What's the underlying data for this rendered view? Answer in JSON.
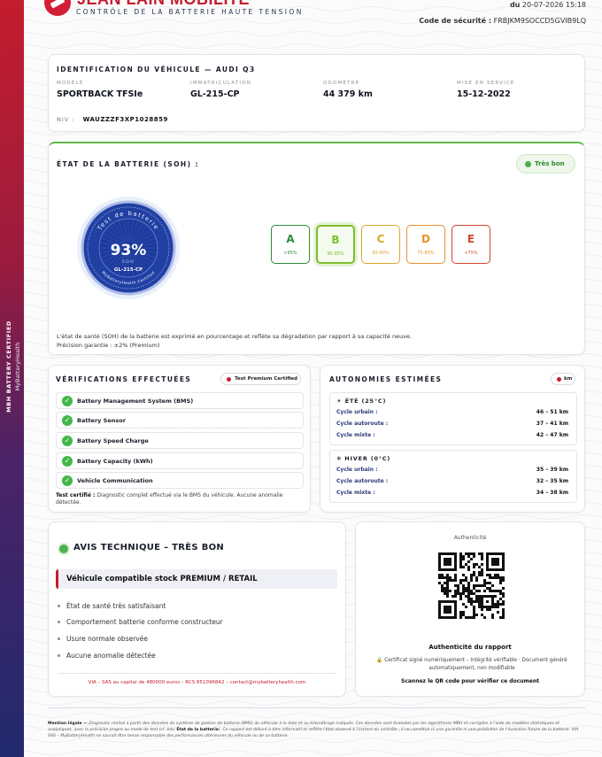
{
  "header": {
    "brand": "JEAN LAIN MOBILITÉ",
    "subtitle": "CONTRÔLE DE LA BATTERIE HAUTE TENSION",
    "date_prefix": "du",
    "date_value": "20-07-2026 15:18",
    "code_label": "Code de sécurité :",
    "code_value": "FRBJKM9SOCCD5GVIB9LQ"
  },
  "sidebar": {
    "line1": "MBH BATTERY CERTIFIED",
    "line2": "MyBatteryHealth"
  },
  "vehicle": {
    "title": "IDENTIFICATION DU VÉHICULE — AUDI Q3",
    "fields": [
      {
        "label": "MODÈLE",
        "value": "SPORTBACK TFSIe"
      },
      {
        "label": "IMMATRICULATION",
        "value": "GL-215-CP"
      },
      {
        "label": "ODOMÈTRE",
        "value": "44 379 km"
      },
      {
        "label": "MISE EN SERVICE",
        "value": "15-12-2022"
      }
    ],
    "vin_label": "NIV :",
    "vin_value": "WAUZZZF3XP1028859"
  },
  "battery": {
    "title": "ÉTAT DE LA BATTERIE (SOH) :",
    "status": "Très bon",
    "seal": {
      "top_text": "Test de batterie",
      "percent": "93%",
      "soh_label": "SOH",
      "plate": "GL-215-CP",
      "bottom_text": "MyBatteryHealth Certified"
    },
    "soh_value": 93,
    "grades": [
      {
        "letter": "A",
        "range": ">95%",
        "color": "#2e8b3d",
        "selected": false
      },
      {
        "letter": "B",
        "range": "90-95%",
        "color": "#7cbf2e",
        "selected": true
      },
      {
        "letter": "C",
        "range": "85-90%",
        "color": "#d8a82a",
        "selected": false
      },
      {
        "letter": "D",
        "range": "75-85%",
        "color": "#e8902e",
        "selected": false
      },
      {
        "letter": "E",
        "range": "<75%",
        "color": "#d2452e",
        "selected": false
      }
    ],
    "note_line1": "L'état de santé (SOH) de la batterie est exprimé en pourcentage et reflète sa dégradation par rapport à sa capacité neuve.",
    "note_line2": "Précision garantie : ±2% (Premium)"
  },
  "checks": {
    "title": "VÉRIFICATIONS EFFECTUÉES",
    "badge": "Test Premium Certified",
    "items": [
      "Battery Management System (BMS)",
      "Battery Sensor",
      "Battery Speed Charge",
      "Battery Capacity (kWh)",
      "Vehicle Communication"
    ],
    "tested_label": "Test certifié :",
    "tested_text": "Diagnostic complet effectué via le BMS du véhicule. Aucune anomalie détectée."
  },
  "autonomy": {
    "title": "AUTONOMIES ESTIMÉES",
    "unit": "km",
    "summer": {
      "title": "☀ ÉTÉ (25°C)",
      "rows": [
        {
          "label": "Cycle urbain :",
          "value": "46 – 51 km"
        },
        {
          "label": "Cycle autoroute :",
          "value": "37 – 41 km"
        },
        {
          "label": "Cycle mixte :",
          "value": "42 – 47 km"
        }
      ]
    },
    "winter": {
      "title": "❄ HIVER (0°C)",
      "rows": [
        {
          "label": "Cycle urbain :",
          "value": "35 – 39 km"
        },
        {
          "label": "Cycle autoroute :",
          "value": "32 – 35 km"
        },
        {
          "label": "Cycle mixte :",
          "value": "34 – 38 km"
        }
      ]
    }
  },
  "opinion": {
    "title": "AVIS TECHNIQUE – TRÈS BON",
    "banner": "Véhicule compatible stock PREMIUM / RETAIL",
    "items": [
      "État de santé très satisfaisant",
      "Comportement batterie conforme constructeur",
      "Usure normale observée",
      "Aucune anomalie détectée"
    ],
    "footer": "VIA – SAS au capital de 480000 euros – RCS 851096842 – contact@mybatteryhealth.com"
  },
  "auth": {
    "title": "Authenticité",
    "heading": "Authenticité du rapport",
    "desc": "Certificat signé numériquement – Intégrité vérifiable · Document généré automatiquement, non modifiable",
    "scan": "Scannez le QR code pour vérifier ce document"
  },
  "legal": {
    "label": "Mention légale —",
    "text1": "Diagnostic réalisé à partir des données du système de gestion de batterie (BMS) du véhicule à la date et au kilométrage indiqués. Ces données sont évaluées par les algorithmes MBH et corrigées à l'aide de modèles statistiques et analytiques, avec la précision propre au mode de test (cf. bloc",
    "bold": "État de la batterie",
    "text2": "). Ce rapport est délivré à titre informatif et reflète l'état observé à l'instant du contrôle ; il ne constitue ni une garantie ni une prédiction de l'évolution future de la batterie. VIA SAS – MyBatteryHealth ne saurait être tenue responsable des performances ultérieures du véhicule ou de sa batterie."
  },
  "colors": {
    "brand_red": "#c41d2e",
    "navy": "#1f3c9a",
    "good_green": "#4caf50"
  }
}
